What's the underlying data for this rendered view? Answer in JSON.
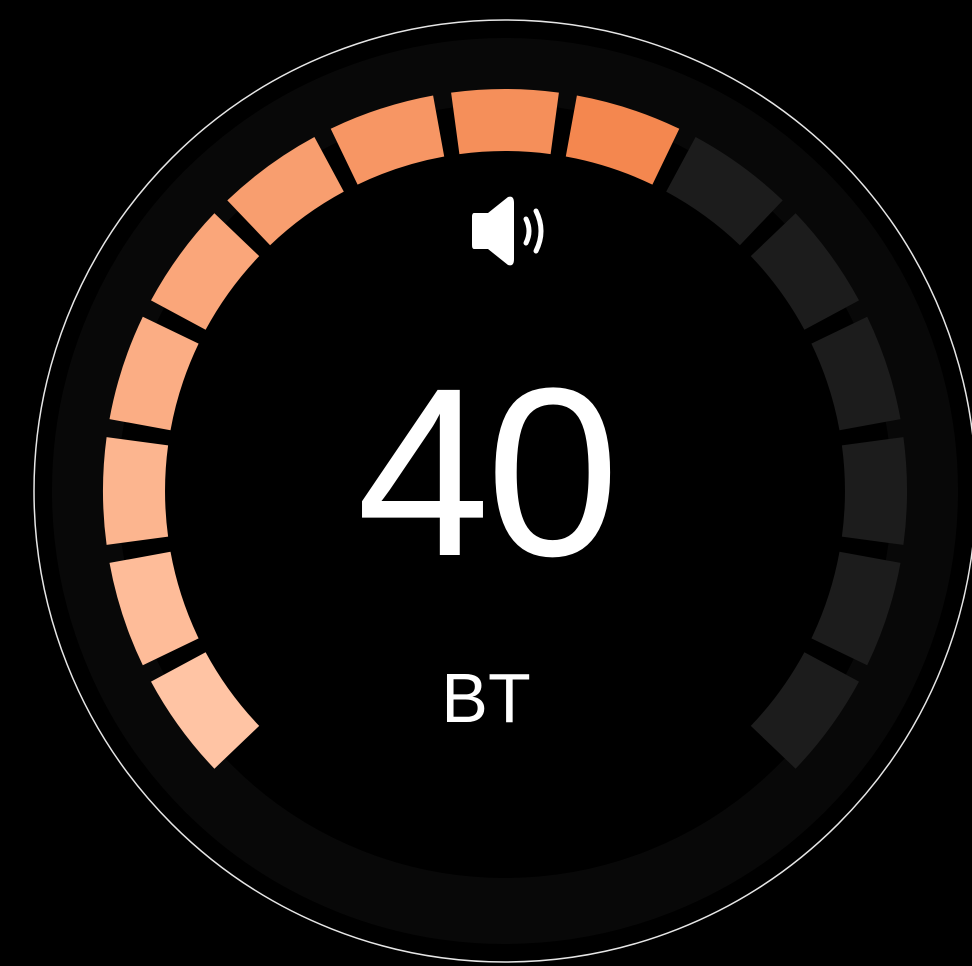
{
  "volume": {
    "value": "40",
    "level": 0.6,
    "output_label": "BT"
  },
  "gauge": {
    "segment_count": 15,
    "active_segments": 9
  },
  "icons": {
    "status": "speaker-volume-icon"
  },
  "colors": {
    "background": "#000000",
    "bezel_ring": "#e6e6e6",
    "track": "#080808",
    "active_start": "#ffc4a4",
    "active_end": "#f4874f",
    "inactive": "#1c1c1c",
    "text": "#ffffff"
  }
}
